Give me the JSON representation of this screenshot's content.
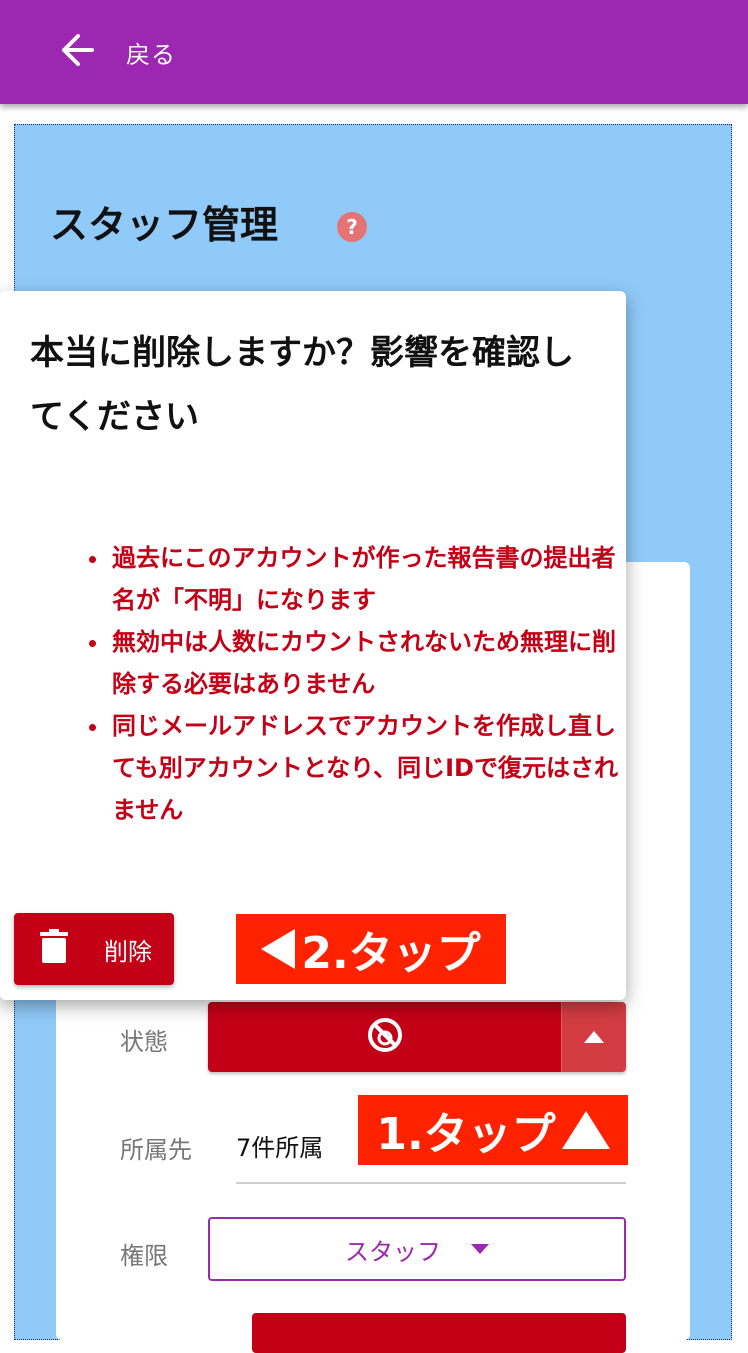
{
  "appbar": {
    "back_label": "戻る"
  },
  "page": {
    "title": "スタッフ管理",
    "help_icon": "?"
  },
  "dialog": {
    "title": "本当に削除しますか？影響を確認してください",
    "notes": [
      "過去にこのアカウントが作った報告書の提出者名が「不明」になります",
      "無効中は人数にカウントされないため無理に削除する必要はありません",
      "同じメールアドレスでアカウントを作成し直しても別アカウントとなり、同じIDで復元はされません"
    ],
    "delete_label": "削除"
  },
  "form": {
    "status_label": "状態",
    "affiliation_label": "所属先",
    "affiliation_value": "7件所属",
    "role_label": "権限",
    "role_value": "スタッフ"
  },
  "callouts": {
    "step1": "1.タップ",
    "step2": "2.タップ"
  },
  "colors": {
    "appbar": "#9c27b0",
    "danger": "#c40016",
    "callout": "#ff2200",
    "background": "#90caf9"
  },
  "icons": {
    "back": "arrow-left-icon",
    "trash": "trash-icon",
    "status": "ban-icon",
    "expand": "triangle-up-icon"
  }
}
